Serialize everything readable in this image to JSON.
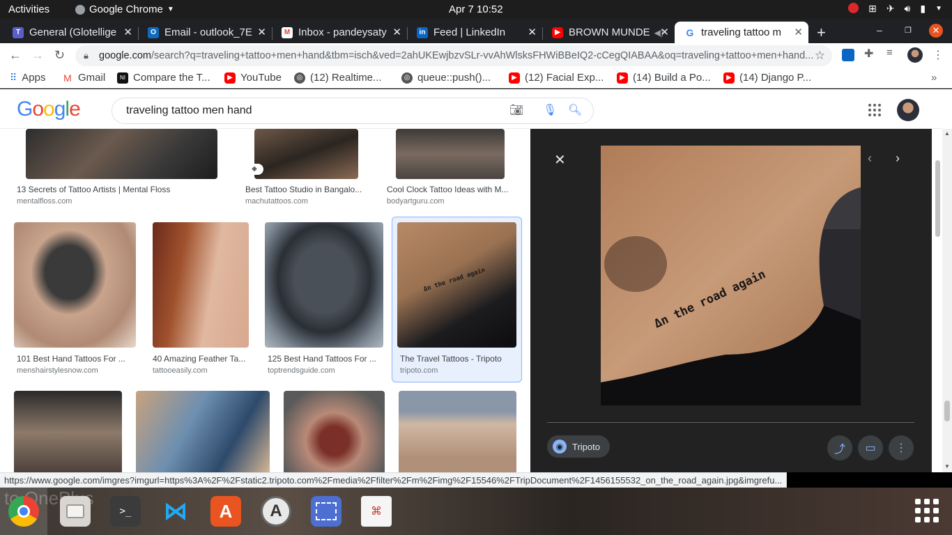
{
  "system": {
    "activities": "Activities",
    "app_name": "Google Chrome",
    "clock": "Apr 7  10:52"
  },
  "tabs": [
    {
      "label": "General (Glotellige",
      "color": "#5b5fc7"
    },
    {
      "label": "Email - outlook_7E",
      "color": "#0f6cbd"
    },
    {
      "label": "Inbox - pandeysaty",
      "color": "#ea4335"
    },
    {
      "label": "Feed | LinkedIn",
      "color": "#0a66c2"
    },
    {
      "label": "BROWN MUNDE",
      "color": "#ff0000"
    },
    {
      "label": "traveling tattoo m",
      "color": "#4285f4"
    }
  ],
  "toolbar": {
    "url_host": "google.com",
    "url_rest": "/search?q=traveling+tattoo+men+hand&tbm=isch&ved=2ahUKEwjbzvSLr-vvAhWlsksFHWiBBeIQ2-cCegQIABAA&oq=traveling+tattoo+men+hand..."
  },
  "bookmarks": [
    {
      "label": "Apps"
    },
    {
      "label": "Gmail"
    },
    {
      "label": "Compare the T..."
    },
    {
      "label": "YouTube"
    },
    {
      "label": "(12) Realtime..."
    },
    {
      "label": "queue::push()..."
    },
    {
      "label": "(12) Facial Exp..."
    },
    {
      "label": "(14) Build a Po..."
    },
    {
      "label": "(14) Django P..."
    }
  ],
  "search": {
    "query": "traveling tattoo men hand"
  },
  "results": {
    "row1": [
      {
        "title": "13 Secrets of Tattoo Artists | Mental Floss",
        "site": "mentalfloss.com"
      },
      {
        "title": "Best Tattoo Studio in Bangalo...",
        "site": "machutattoos.com"
      },
      {
        "title": "Cool Clock Tattoo Ideas with M...",
        "site": "bodyartguru.com"
      }
    ],
    "row2": [
      {
        "title": "101 Best Hand Tattoos For ...",
        "site": "menshairstylesnow.com"
      },
      {
        "title": "40 Amazing Feather Ta...",
        "site": "tattooeasily.com"
      },
      {
        "title": "125 Best Hand Tattoos For ...",
        "site": "toptrendsguide.com"
      },
      {
        "title": "The Travel Tattoos - Tripoto",
        "site": "tripoto.com"
      }
    ]
  },
  "viewer": {
    "tattoo_text": "Δn the road again",
    "source": "Tripoto"
  },
  "status_url": "https://www.google.com/imgres?imgurl=https%3A%2F%2Fstatic2.tripoto.com%2Fmedia%2Ffilter%2Fm%2Fimg%2F15546%2FTripDocument%2F1456155532_on_the_road_again.jpg&imgrefu...",
  "dock": {
    "wallpaper_text": "to OnePlus"
  }
}
